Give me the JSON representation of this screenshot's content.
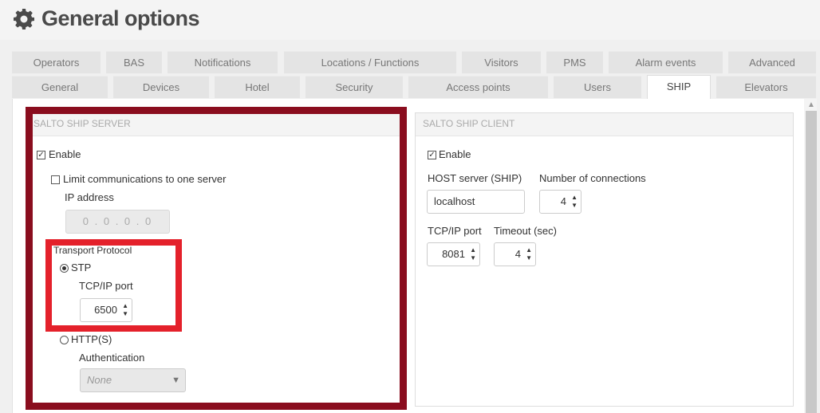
{
  "header": {
    "title": "General options",
    "icon": "gear-icon"
  },
  "tabs_row1": [
    {
      "label": "Operators"
    },
    {
      "label": "BAS"
    },
    {
      "label": "Notifications"
    },
    {
      "label": "Locations / Functions"
    },
    {
      "label": "Visitors"
    },
    {
      "label": "PMS"
    },
    {
      "label": "Alarm events"
    },
    {
      "label": "Advanced"
    }
  ],
  "tabs_row2": [
    {
      "label": "General"
    },
    {
      "label": "Devices"
    },
    {
      "label": "Hotel"
    },
    {
      "label": "Security"
    },
    {
      "label": "Access points"
    },
    {
      "label": "Users"
    },
    {
      "label": "SHIP",
      "active": true
    },
    {
      "label": "Elevators"
    }
  ],
  "server": {
    "title": "SALTO SHIP SERVER",
    "enable_label": "Enable",
    "enable_checked": true,
    "limit_label": "Limit communications to one server",
    "limit_checked": false,
    "ip_label": "IP address",
    "ip_value": "0 . 0 . 0 . 0",
    "transport_label": "Transport Protocol",
    "stp_label": "STP",
    "stp_selected": true,
    "stp_port_label": "TCP/IP port",
    "stp_port_value": "6500",
    "https_label": "HTTP(S)",
    "https_selected": false,
    "auth_label": "Authentication",
    "auth_value": "None"
  },
  "client": {
    "title": "SALTO SHIP CLIENT",
    "enable_label": "Enable",
    "enable_checked": true,
    "host_label": "HOST server (SHIP)",
    "host_value": "localhost",
    "connections_label": "Number of connections",
    "connections_value": "4",
    "port_label": "TCP/IP port",
    "port_value": "8081",
    "timeout_label": "Timeout (sec)",
    "timeout_value": "4"
  },
  "colors": {
    "highlight_outer": "#8a0d1e",
    "highlight_inner": "#e4212b"
  }
}
